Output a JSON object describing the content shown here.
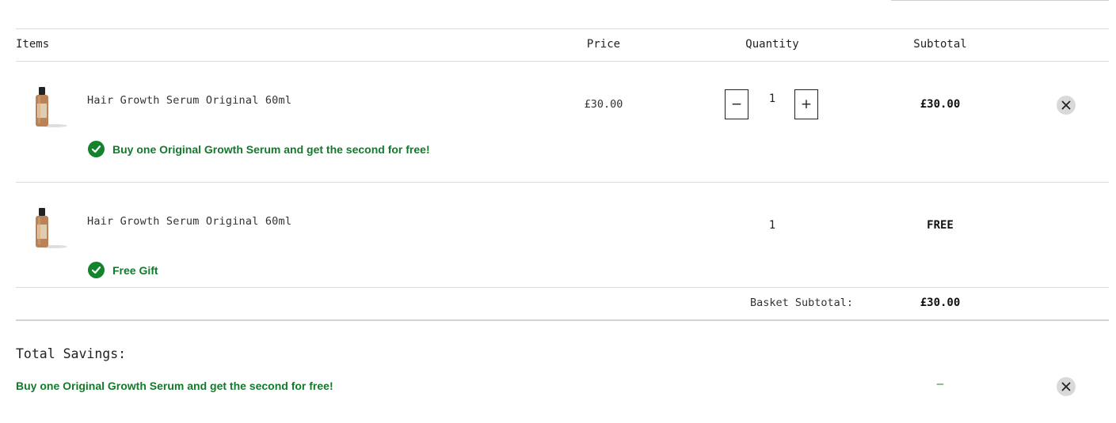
{
  "table": {
    "headers": {
      "items": "Items",
      "price": "Price",
      "quantity": "Quantity",
      "subtotal": "Subtotal"
    }
  },
  "rows": [
    {
      "product_name": "Hair Growth Serum Original 60ml",
      "price": "£30.00",
      "quantity": "1",
      "subtotal": "£30.00",
      "promo": "Buy one Original Growth Serum and get the second for free!"
    },
    {
      "product_name": "Hair Growth Serum Original 60ml",
      "price": "",
      "quantity": "1",
      "subtotal": "FREE",
      "promo": "Free Gift"
    }
  ],
  "basket": {
    "subtotal_label": "Basket Subtotal:",
    "subtotal_value": "£30.00"
  },
  "savings": {
    "title": "Total Savings:",
    "line_label": "Buy one Original Growth Serum and get the second for free!",
    "line_value": "–"
  },
  "controls": {
    "decrease_symbol": "−",
    "increase_symbol": "+"
  },
  "colors": {
    "promo_green": "#127a2a",
    "check_green": "#13842c",
    "remove_bg": "#d9d9d9"
  },
  "icons": {
    "check": "check-circle-icon",
    "remove": "close-icon",
    "product": "serum-bottle-icon"
  }
}
